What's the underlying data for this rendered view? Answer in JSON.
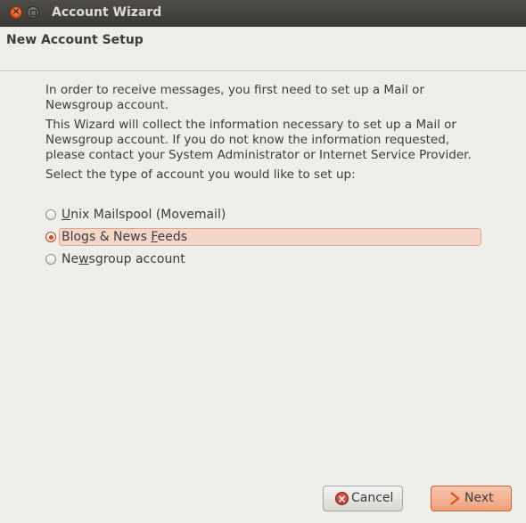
{
  "window": {
    "title": "Account Wizard"
  },
  "header": {
    "title": "New Account Setup"
  },
  "intro": {
    "paragraph1_line1": "In order to receive messages, you first need to set up a Mail or",
    "paragraph1_line2": "Newsgroup account.",
    "paragraph2_line1": "This Wizard will collect the information necessary to set up a Mail or",
    "paragraph2_line2": "Newsgroup account. If you do not know the information requested,",
    "paragraph2_line3": "please contact your System Administrator or Internet Service Provider.",
    "prompt": "Select the type of account you would like to set up:"
  },
  "account_types": [
    {
      "label": "Unix Mailspool (Movemail)",
      "selected": false
    },
    {
      "label": "Blogs & News Feeds",
      "selected": true
    },
    {
      "label": "Newsgroup account",
      "selected": false
    }
  ],
  "buttons": {
    "cancel_label": "Cancel",
    "next_label": "Next"
  },
  "icons": {
    "window_close": "close-icon",
    "window_maximize": "maximize-icon",
    "cancel": "cancel-icon",
    "next": "next-arrow-icon"
  },
  "colors": {
    "titlebar": "#3c3b37",
    "accent": "#dd4814",
    "selection": "#f3d6c8",
    "next_button": "#eea17c"
  }
}
